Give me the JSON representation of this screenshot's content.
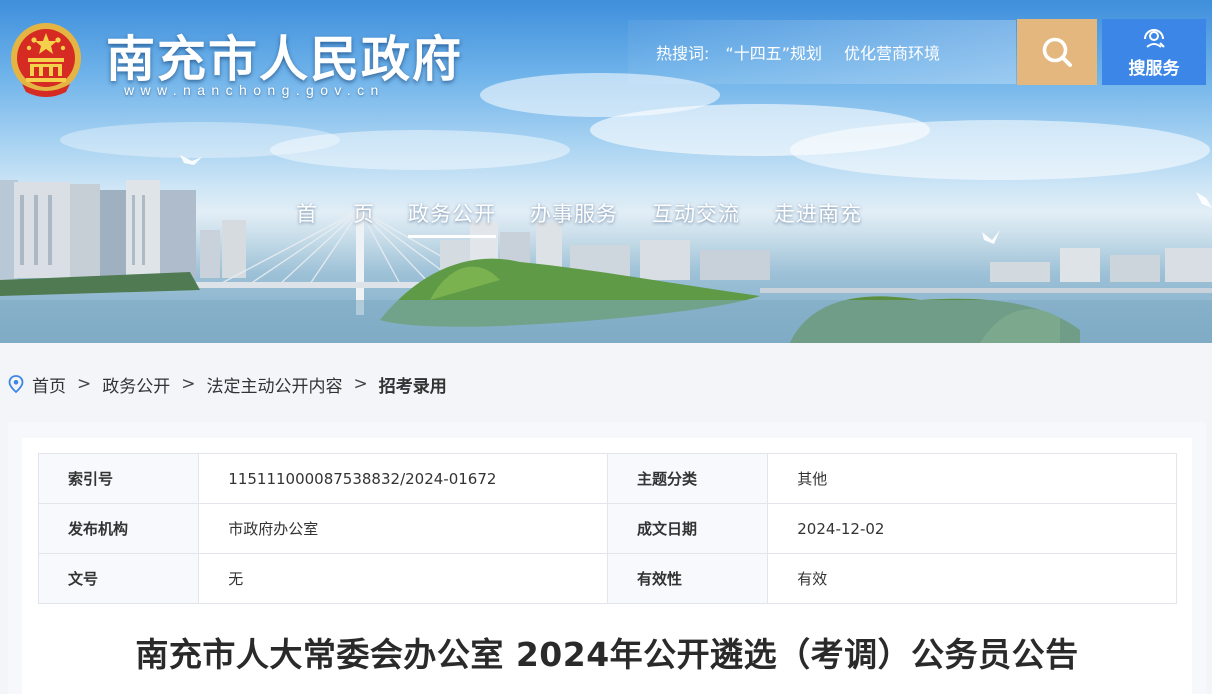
{
  "site": {
    "title": "南充市人民政府",
    "url": "www.nanchong.gov.cn"
  },
  "hot_search": {
    "label": "热搜词:",
    "items": [
      "“十四五”规划",
      "优化营商环境"
    ]
  },
  "search_button": {
    "icon": "search-icon"
  },
  "service_button": {
    "label": "搜服务",
    "icon": "service-search-icon"
  },
  "nav": {
    "items": [
      {
        "label": "首页",
        "active": false
      },
      {
        "label": "政务公开",
        "active": true
      },
      {
        "label": "办事服务",
        "active": false
      },
      {
        "label": "互动交流",
        "active": false
      },
      {
        "label": "走进南充",
        "active": false
      }
    ]
  },
  "breadcrumb": {
    "icon": "location-pin-icon",
    "items": [
      "首页",
      "政务公开",
      "法定主动公开内容",
      "招考录用"
    ],
    "separator": ">"
  },
  "meta": {
    "rows": [
      {
        "k1": "索引号",
        "v1": "11511100008753883​2/2024-01672",
        "k2": "主题分类",
        "v2": "其他"
      },
      {
        "k1": "发布机构",
        "v1": "市政府办公室",
        "k2": "成文日期",
        "v2": "2024-12-02"
      },
      {
        "k1": "文号",
        "v1": "无",
        "k2": "有效性",
        "v2": "有效"
      }
    ]
  },
  "article": {
    "title": "南充市人大常委会办公室 2024年公开遴选（考调）公务员公告"
  },
  "colors": {
    "search_button": "#e3b77e",
    "service_button": "#3b86e6",
    "breadcrumb_icon": "#3b86e6"
  }
}
